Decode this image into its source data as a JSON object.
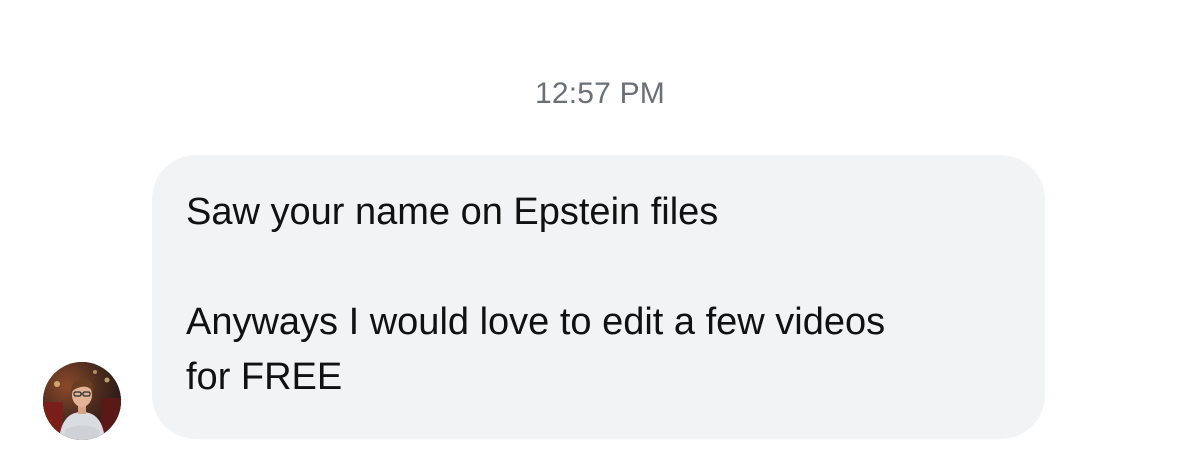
{
  "conversation": {
    "timestamp": "12:57 PM",
    "messages": [
      {
        "sender": "other",
        "lines": [
          "Saw your name on Epstein files",
          "",
          "Anyways I would love to edit a few videos",
          "for FREE"
        ]
      }
    ]
  },
  "colors": {
    "bubble_background": "#f2f3f5",
    "timestamp_text": "#6b7078",
    "message_text": "#111111",
    "page_background": "#ffffff"
  },
  "icons": {
    "avatar": "user-avatar-photo"
  }
}
